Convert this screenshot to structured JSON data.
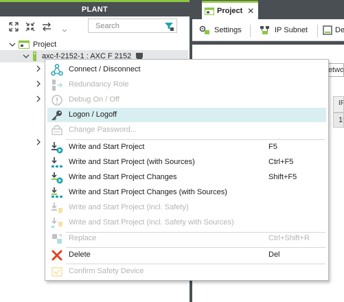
{
  "plant": {
    "title": "PLANT",
    "search_placeholder": "Search",
    "tree": {
      "root_label": "Project",
      "device_label": "axc-f-2152-1 : AXC F 2152"
    }
  },
  "document": {
    "tab_label": "Project",
    "close_glyph": "✕",
    "subtabs": [
      {
        "label": "Settings"
      },
      {
        "label": "IP Subnet"
      },
      {
        "label": "De"
      }
    ],
    "network_tab_label": "Netwo",
    "grid_header": "IP",
    "grid_cell": "19"
  },
  "context_menu": {
    "items": [
      {
        "label": "Connect / Disconnect",
        "shortcut": "",
        "enabled": true,
        "icon": "network-connect-icon"
      },
      {
        "label": "Redundancy Role",
        "shortcut": "",
        "enabled": false,
        "icon": "redundancy-role-icon"
      },
      {
        "label": "Debug On / Off",
        "shortcut": "",
        "enabled": false,
        "icon": "debug-icon"
      },
      {
        "label": "Logon / Logoff",
        "shortcut": "",
        "enabled": true,
        "icon": "key-icon"
      },
      {
        "label": "Change Password...",
        "shortcut": "",
        "enabled": false,
        "icon": "change-password-icon"
      },
      {
        "label": "Write and Start Project",
        "shortcut": "F5",
        "enabled": true,
        "icon": "write-start-icon"
      },
      {
        "label": "Write and Start Project (with Sources)",
        "shortcut": "Ctrl+F5",
        "enabled": true,
        "icon": "write-start-sources-icon"
      },
      {
        "label": "Write and Start Project Changes",
        "shortcut": "Shift+F5",
        "enabled": true,
        "icon": "write-changes-icon"
      },
      {
        "label": "Write and Start Project Changes (with Sources)",
        "shortcut": "",
        "enabled": true,
        "icon": "write-changes-sources-icon"
      },
      {
        "label": "Write and Start Project (incl. Safety)",
        "shortcut": "",
        "enabled": false,
        "icon": "write-safety-icon"
      },
      {
        "label": "Write and Start Project (incl. Safety with Sources)",
        "shortcut": "",
        "enabled": false,
        "icon": "write-safety-sources-icon"
      },
      {
        "label": "Replace",
        "shortcut": "Ctrl+Shift+R",
        "enabled": false,
        "icon": "replace-icon"
      },
      {
        "label": "Delete",
        "shortcut": "Del",
        "enabled": true,
        "icon": "delete-icon"
      },
      {
        "label": "Confirm Safety Device",
        "shortcut": "",
        "enabled": false,
        "icon": "confirm-safety-icon"
      }
    ],
    "highlighted_index": 3
  },
  "colors": {
    "accent_green": "#8dc63f",
    "chrome_dark": "#4a4f54",
    "highlight": "#d9eef0",
    "delete_red": "#e2401c",
    "icon_teal": "#1aa3b0"
  }
}
